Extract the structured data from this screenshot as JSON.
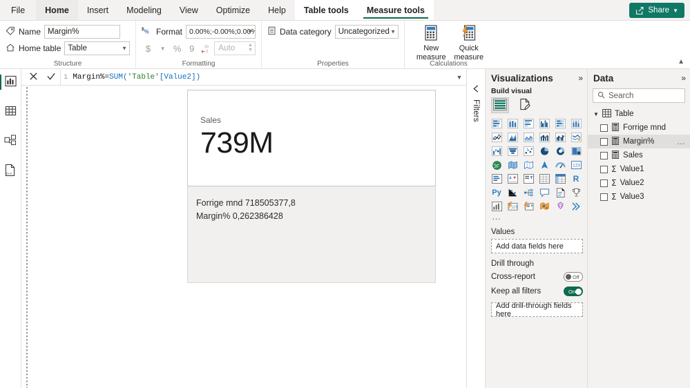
{
  "ribbon": {
    "tabs": [
      {
        "label": "File",
        "state": "file"
      },
      {
        "label": "Home",
        "state": "home-active"
      },
      {
        "label": "Insert",
        "state": "normal"
      },
      {
        "label": "Modeling",
        "state": "normal"
      },
      {
        "label": "View",
        "state": "normal"
      },
      {
        "label": "Optimize",
        "state": "normal"
      },
      {
        "label": "Help",
        "state": "normal"
      },
      {
        "label": "Table tools",
        "state": "ctx"
      },
      {
        "label": "Measure tools",
        "state": "ctx-active"
      }
    ],
    "share_label": "Share",
    "groups": {
      "structure": {
        "label": "Structure",
        "name_label": "Name",
        "name_value": "Margin%",
        "home_table_label": "Home table",
        "home_table_value": "Table"
      },
      "formatting": {
        "label": "Formatting",
        "format_label": "Format",
        "format_value": "0.00%;-0.00%;0.00%",
        "currency_label": "$",
        "percent_label": "%",
        "comma_label": "9",
        "decimals_label": ".00",
        "decimal_places_value": "Auto"
      },
      "properties": {
        "label": "Properties",
        "data_category_label": "Data category",
        "data_category_value": "Uncategorized"
      },
      "calculations": {
        "label": "Calculations",
        "new_measure_line1": "New",
        "new_measure_line2": "measure",
        "quick_measure_line1": "Quick",
        "quick_measure_line2": "measure"
      }
    }
  },
  "rail": {
    "items": [
      {
        "name": "report-view",
        "active": true
      },
      {
        "name": "data-view",
        "active": false
      },
      {
        "name": "model-view",
        "active": false
      },
      {
        "name": "dax-query-view",
        "active": false
      }
    ]
  },
  "formula_bar": {
    "line_number": "1",
    "measure_name": "Margin%",
    "equals": " = ",
    "function": "SUM(",
    "table_ref": "'Table'",
    "column_ref": "[Value2]",
    "close": ")"
  },
  "canvas": {
    "card": {
      "label": "Sales",
      "value": "739M"
    },
    "tooltip": {
      "line1": "Forrige mnd 718505377,8",
      "line2": "Margin% 0,262386428"
    }
  },
  "filters": {
    "title": "Filters"
  },
  "visualizations": {
    "title": "Visualizations",
    "build_visual": "Build visual",
    "tabs": [
      {
        "name": "fields-tab",
        "selected": true
      },
      {
        "name": "format-tab",
        "selected": false
      }
    ],
    "icons": [
      "stacked-bar-chart-icon",
      "stacked-column-chart-icon",
      "clustered-bar-chart-icon",
      "clustered-column-chart-icon",
      "100-stacked-bar-chart-icon",
      "100-stacked-column-chart-icon",
      "line-chart-icon",
      "area-chart-icon",
      "stacked-area-chart-icon",
      "line-stacked-column-chart-icon",
      "line-clustered-column-chart-icon",
      "ribbon-chart-icon",
      "waterfall-chart-icon",
      "funnel-chart-icon",
      "scatter-chart-icon",
      "pie-chart-icon",
      "donut-chart-icon",
      "treemap-icon",
      "map-icon",
      "filled-map-icon",
      "shape-map-icon",
      "azure-map-icon",
      "gauge-icon",
      "card-icon",
      "multi-row-card-icon",
      "kpi-icon",
      "slicer-icon",
      "table-icon",
      "matrix-icon",
      "r-script-visual-icon",
      "python-visual-icon",
      "key-influencers-icon",
      "decomposition-tree-icon",
      "qa-visual-icon",
      "narrative-icon",
      "metrics-icon",
      "paginated-report-icon",
      "power-apps-icon",
      "power-automate-icon",
      "arcgis-maps-icon",
      "scorecard-icon",
      "chiclet-slicer-icon"
    ],
    "more_icon": "…",
    "wells": {
      "values_label": "Values",
      "values_placeholder": "Add data fields here",
      "drill_through_label": "Drill through",
      "cross_report_label": "Cross-report",
      "cross_report_state": "Off",
      "keep_all_filters_label": "Keep all filters",
      "keep_all_filters_state": "On",
      "drill_placeholder": "Add drill-through fields here"
    }
  },
  "data_pane": {
    "title": "Data",
    "search_placeholder": "Search",
    "table": {
      "name": "Table",
      "expanded": true,
      "fields": [
        {
          "label": "Forrige mnd",
          "type": "measure",
          "selected": false
        },
        {
          "label": "Margin%",
          "type": "measure",
          "selected": true
        },
        {
          "label": "Sales",
          "type": "measure",
          "selected": false
        },
        {
          "label": "Value1",
          "type": "sum",
          "selected": false
        },
        {
          "label": "Value2",
          "type": "sum",
          "selected": false
        },
        {
          "label": "Value3",
          "type": "sum",
          "selected": false
        }
      ]
    }
  },
  "colors": {
    "accent_green": "#117865",
    "tab_underline": "#0b6a4f",
    "icon_blue": "#3a78b5",
    "pane_bg": "#f3f2f1"
  }
}
